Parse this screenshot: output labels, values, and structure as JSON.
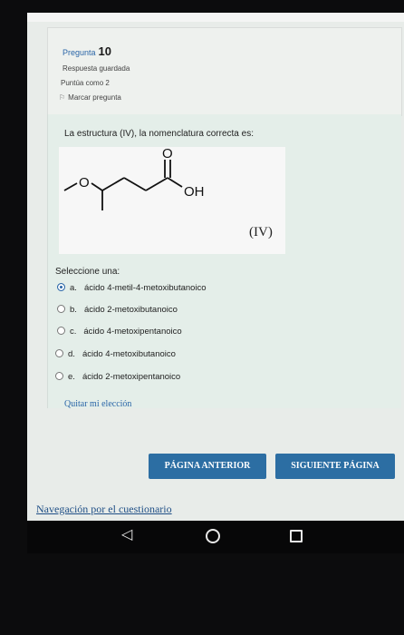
{
  "header": {
    "question_label": "Pregunta",
    "question_number": "10",
    "saved_status": "Respuesta guardada",
    "score": "Puntúa como 2",
    "flag_label": "Marcar pregunta"
  },
  "question": {
    "text": "La estructura (IV), la nomenclatura correcta es:",
    "molecule": {
      "oxygen": "O",
      "carbonyl_oxygen": "O",
      "hydroxyl": "OH",
      "label": "(IV)"
    },
    "select_prompt": "Seleccione una:",
    "options": [
      {
        "letter": "a.",
        "text": "ácido 4-metil-4-metoxibutanoico",
        "selected": true
      },
      {
        "letter": "b.",
        "text": "ácido 2-metoxibutanoico",
        "selected": false
      },
      {
        "letter": "c.",
        "text": "ácido 4-metoxipentanoico",
        "selected": false
      },
      {
        "letter": "d.",
        "text": "ácido 4-metoxibutanoico",
        "selected": false
      },
      {
        "letter": "e.",
        "text": "ácido 2-metoxipentanoico",
        "selected": false
      }
    ],
    "clear_choice": "Quitar mi elección"
  },
  "navigation": {
    "previous_button": "PÁGINA ANTERIOR",
    "next_button": "SIGUIENTE PÁGINA",
    "quiz_navigation_link": "Navegación por el cuestionario"
  },
  "android_nav": {
    "back_icon": "triangle-back-icon",
    "home_icon": "circle-home-icon",
    "recent_icon": "square-recent-icon"
  },
  "colors": {
    "accent": "#2c6ea3",
    "link": "#2b66a8"
  }
}
